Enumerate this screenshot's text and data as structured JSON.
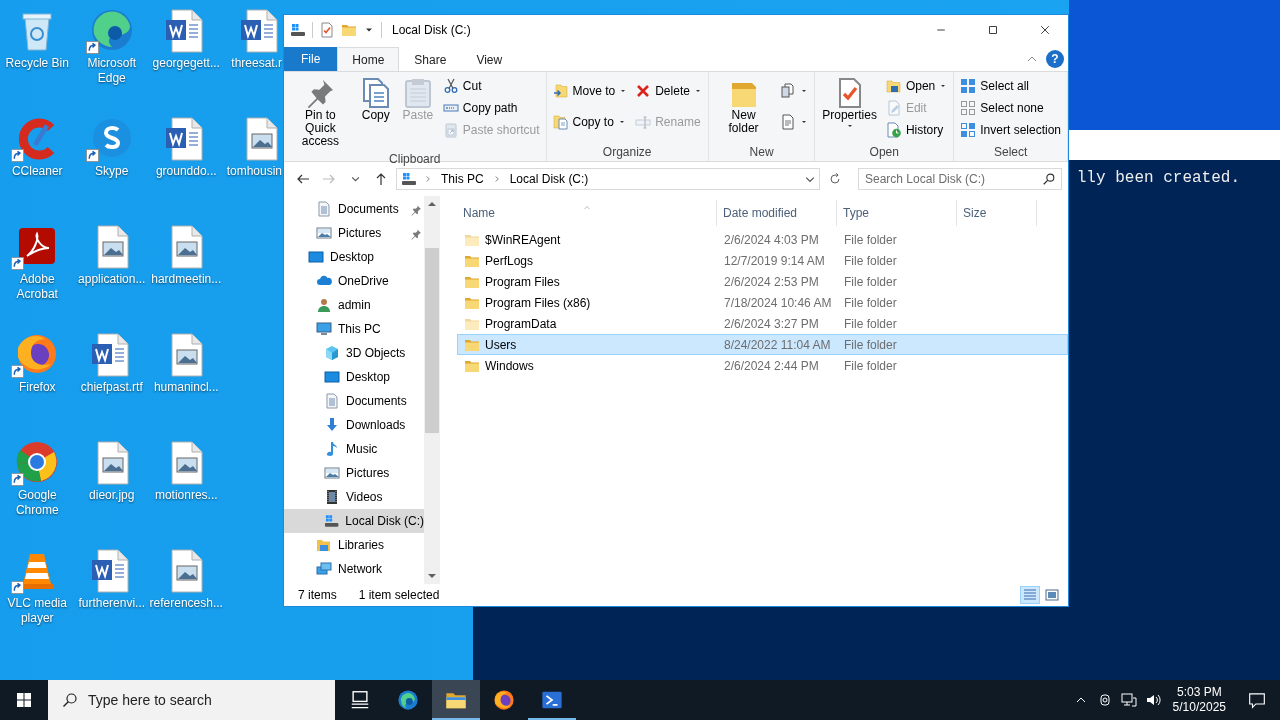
{
  "desktop": {
    "icons": [
      {
        "label": "Recycle Bin",
        "shortcut": false
      },
      {
        "label": "CCleaner",
        "shortcut": true
      },
      {
        "label": "Adobe Acrobat",
        "shortcut": true
      },
      {
        "label": "Firefox",
        "shortcut": true
      },
      {
        "label": "Google Chrome",
        "shortcut": true
      },
      {
        "label": "VLC media player",
        "shortcut": true
      },
      {
        "label": "Microsoft Edge",
        "shortcut": true
      },
      {
        "label": "Skype",
        "shortcut": true
      },
      {
        "label": "application...",
        "shortcut": false
      },
      {
        "label": "chiefpast.rtf",
        "shortcut": false
      },
      {
        "label": "dieor.jpg",
        "shortcut": false
      },
      {
        "label": "furtherenvi...",
        "shortcut": false
      },
      {
        "label": "georgegett...",
        "shortcut": false
      },
      {
        "label": "grounddo...",
        "shortcut": false
      },
      {
        "label": "hardmeetin...",
        "shortcut": false
      },
      {
        "label": "humanincl...",
        "shortcut": false
      },
      {
        "label": "motionres...",
        "shortcut": false
      },
      {
        "label": "referencesh...",
        "shortcut": false
      },
      {
        "label": "threesat.r",
        "shortcut": false
      },
      {
        "label": "tomhousin",
        "shortcut": false
      }
    ]
  },
  "console": {
    "text": "lly been created."
  },
  "explorer": {
    "title": "Local Disk (C:)",
    "file_tab": "File",
    "tabs": [
      {
        "label": "Home",
        "kind": "tab",
        "selected": true
      },
      {
        "label": "Share",
        "kind": "tab",
        "selected": false
      },
      {
        "label": "View",
        "kind": "tab",
        "selected": false
      }
    ],
    "help": "?",
    "ribbon": [
      {
        "label": "Clipboard",
        "columns": [
          [
            {
              "label": "Pin to Quick access",
              "kind": "large",
              "disabled": false
            }
          ],
          [
            {
              "label": "Copy",
              "kind": "large",
              "disabled": false
            }
          ],
          [
            {
              "label": "Paste",
              "kind": "large",
              "disabled": true
            }
          ],
          [
            {
              "label": "Cut",
              "kind": "small",
              "disabled": false
            },
            {
              "label": "Copy path",
              "kind": "small",
              "disabled": false
            },
            {
              "label": "Paste shortcut",
              "kind": "small",
              "disabled": true
            }
          ]
        ]
      },
      {
        "label": "Organize",
        "columns": [
          [
            {
              "label": "Move to",
              "kind": "small",
              "disabled": false,
              "dropdown": true
            },
            {
              "label": "Copy to",
              "kind": "small",
              "disabled": false,
              "dropdown": true
            }
          ],
          [
            {
              "label": "Delete",
              "kind": "small",
              "disabled": false,
              "dropdown": true
            },
            {
              "label": "Rename",
              "kind": "small",
              "disabled": true
            }
          ]
        ]
      },
      {
        "label": "New",
        "columns": [
          [
            {
              "label": "New folder",
              "kind": "large",
              "disabled": false
            }
          ],
          [
            {
              "kind": "icon",
              "disabled": false,
              "dropdown": true
            },
            {
              "kind": "icon",
              "disabled": false,
              "dropdown": true
            }
          ]
        ]
      },
      {
        "label": "Open",
        "columns": [
          [
            {
              "label": "Properties",
              "kind": "large",
              "disabled": false,
              "dropdown": true
            }
          ],
          [
            {
              "label": "Open",
              "kind": "small",
              "disabled": false,
              "dropdown": true
            },
            {
              "label": "Edit",
              "kind": "small",
              "disabled": true
            },
            {
              "label": "History",
              "kind": "small",
              "disabled": false
            }
          ]
        ]
      },
      {
        "label": "Select",
        "columns": [
          [
            {
              "label": "Select all",
              "kind": "small",
              "disabled": false
            },
            {
              "label": "Select none",
              "kind": "small",
              "disabled": false
            },
            {
              "label": "Invert selection",
              "kind": "small",
              "disabled": false
            }
          ]
        ]
      }
    ],
    "address": {
      "path": [
        "This PC",
        "Local Disk (C:)"
      ]
    },
    "search": {
      "placeholder": "Search Local Disk (C:)"
    },
    "nav": [
      {
        "label": "Documents",
        "pinned": true,
        "selected": false
      },
      {
        "label": "Pictures",
        "pinned": true,
        "selected": false
      },
      {
        "label": "Desktop",
        "pinned": false,
        "selected": false,
        "children": [
          {
            "label": "OneDrive",
            "pinned": false,
            "selected": false
          },
          {
            "label": "admin",
            "pinned": false,
            "selected": false
          },
          {
            "label": "This PC",
            "pinned": false,
            "selected": false,
            "children": [
              {
                "label": "3D Objects",
                "pinned": false,
                "selected": false
              },
              {
                "label": "Desktop",
                "pinned": false,
                "selected": false
              },
              {
                "label": "Documents",
                "pinned": false,
                "selected": false
              },
              {
                "label": "Downloads",
                "pinned": false,
                "selected": false
              },
              {
                "label": "Music",
                "pinned": false,
                "selected": false
              },
              {
                "label": "Pictures",
                "pinned": false,
                "selected": false
              },
              {
                "label": "Videos",
                "pinned": false,
                "selected": false
              },
              {
                "label": "Local Disk (C:)",
                "pinned": false,
                "selected": true
              }
            ]
          },
          {
            "label": "Libraries",
            "pinned": false,
            "selected": false
          },
          {
            "label": "Network",
            "pinned": false,
            "selected": false
          }
        ]
      }
    ],
    "columns": [
      "Name",
      "Date modified",
      "Type",
      "Size"
    ],
    "rows": [
      {
        "name": "$WinREAgent",
        "date": "2/6/2024 4:03 PM",
        "type": "File folder",
        "hidden": true,
        "selected": false
      },
      {
        "name": "PerfLogs",
        "date": "12/7/2019 9:14 AM",
        "type": "File folder",
        "hidden": false,
        "selected": false
      },
      {
        "name": "Program Files",
        "date": "2/6/2024 2:53 PM",
        "type": "File folder",
        "hidden": false,
        "selected": false
      },
      {
        "name": "Program Files (x86)",
        "date": "7/18/2024 10:46 AM",
        "type": "File folder",
        "hidden": false,
        "selected": false
      },
      {
        "name": "ProgramData",
        "date": "2/6/2024 3:27 PM",
        "type": "File folder",
        "hidden": true,
        "selected": false
      },
      {
        "name": "Users",
        "date": "8/24/2022 11:04 AM",
        "type": "File folder",
        "hidden": false,
        "selected": true
      },
      {
        "name": "Windows",
        "date": "2/6/2024 2:44 PM",
        "type": "File folder",
        "hidden": false,
        "selected": false
      }
    ],
    "status": {
      "count": "7 items",
      "selection": "1 item selected"
    },
    "view_buttons": [
      {
        "selected": true
      },
      {
        "selected": false
      }
    ]
  },
  "taskbar": {
    "search": {
      "placeholder": "Type here to search"
    },
    "apps": [
      {
        "active": false,
        "running": false
      },
      {
        "active": false,
        "running": false
      },
      {
        "active": true,
        "running": true
      },
      {
        "active": false,
        "running": false
      },
      {
        "active": false,
        "running": true
      }
    ],
    "time": "5:03 PM",
    "date": "5/10/2025"
  }
}
